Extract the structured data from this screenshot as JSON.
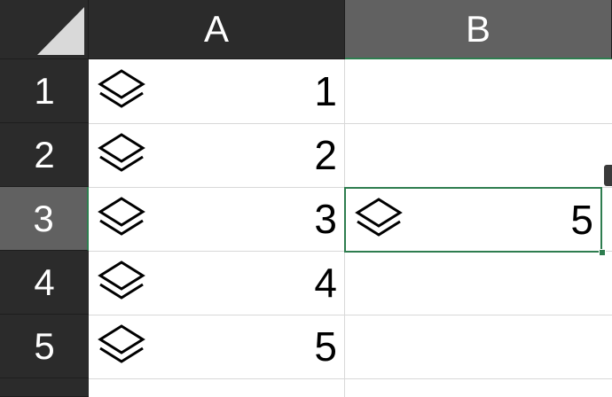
{
  "columns": [
    {
      "label": "A",
      "selected": false
    },
    {
      "label": "B",
      "selected": true
    }
  ],
  "rows": [
    {
      "label": "1",
      "selected": false
    },
    {
      "label": "2",
      "selected": false
    },
    {
      "label": "3",
      "selected": true
    },
    {
      "label": "4",
      "selected": false
    },
    {
      "label": "5",
      "selected": false
    }
  ],
  "cells": {
    "A1": {
      "value": "1",
      "icon": "layers-icon"
    },
    "A2": {
      "value": "2",
      "icon": "layers-icon"
    },
    "A3": {
      "value": "3",
      "icon": "layers-icon"
    },
    "A4": {
      "value": "4",
      "icon": "layers-icon"
    },
    "A5": {
      "value": "5",
      "icon": "layers-icon"
    },
    "B3": {
      "value": "5",
      "icon": "layers-icon"
    }
  },
  "active_cell": "B3",
  "colors": {
    "header_bg": "#2b2b2b",
    "header_selected_bg": "#616161",
    "selection_border": "#2e7d4f",
    "gridline": "#d8d8d8"
  }
}
